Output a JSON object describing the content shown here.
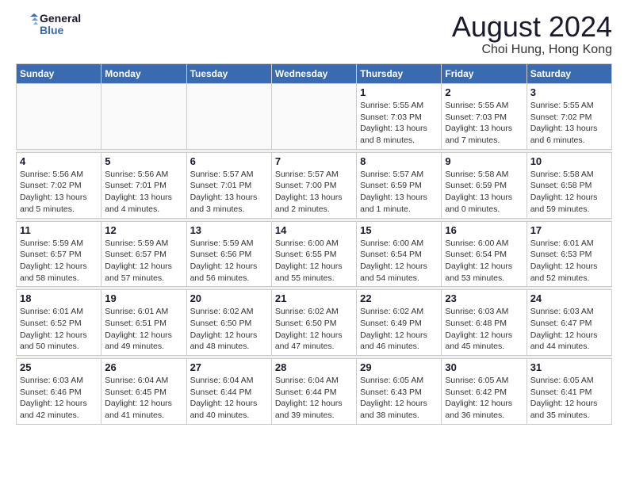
{
  "header": {
    "logo_line1": "General",
    "logo_line2": "Blue",
    "month_year": "August 2024",
    "location": "Choi Hung, Hong Kong"
  },
  "weekdays": [
    "Sunday",
    "Monday",
    "Tuesday",
    "Wednesday",
    "Thursday",
    "Friday",
    "Saturday"
  ],
  "weeks": [
    [
      {
        "day": "",
        "info": ""
      },
      {
        "day": "",
        "info": ""
      },
      {
        "day": "",
        "info": ""
      },
      {
        "day": "",
        "info": ""
      },
      {
        "day": "1",
        "info": "Sunrise: 5:55 AM\nSunset: 7:03 PM\nDaylight: 13 hours\nand 8 minutes."
      },
      {
        "day": "2",
        "info": "Sunrise: 5:55 AM\nSunset: 7:03 PM\nDaylight: 13 hours\nand 7 minutes."
      },
      {
        "day": "3",
        "info": "Sunrise: 5:55 AM\nSunset: 7:02 PM\nDaylight: 13 hours\nand 6 minutes."
      }
    ],
    [
      {
        "day": "4",
        "info": "Sunrise: 5:56 AM\nSunset: 7:02 PM\nDaylight: 13 hours\nand 5 minutes."
      },
      {
        "day": "5",
        "info": "Sunrise: 5:56 AM\nSunset: 7:01 PM\nDaylight: 13 hours\nand 4 minutes."
      },
      {
        "day": "6",
        "info": "Sunrise: 5:57 AM\nSunset: 7:01 PM\nDaylight: 13 hours\nand 3 minutes."
      },
      {
        "day": "7",
        "info": "Sunrise: 5:57 AM\nSunset: 7:00 PM\nDaylight: 13 hours\nand 2 minutes."
      },
      {
        "day": "8",
        "info": "Sunrise: 5:57 AM\nSunset: 6:59 PM\nDaylight: 13 hours\nand 1 minute."
      },
      {
        "day": "9",
        "info": "Sunrise: 5:58 AM\nSunset: 6:59 PM\nDaylight: 13 hours\nand 0 minutes."
      },
      {
        "day": "10",
        "info": "Sunrise: 5:58 AM\nSunset: 6:58 PM\nDaylight: 12 hours\nand 59 minutes."
      }
    ],
    [
      {
        "day": "11",
        "info": "Sunrise: 5:59 AM\nSunset: 6:57 PM\nDaylight: 12 hours\nand 58 minutes."
      },
      {
        "day": "12",
        "info": "Sunrise: 5:59 AM\nSunset: 6:57 PM\nDaylight: 12 hours\nand 57 minutes."
      },
      {
        "day": "13",
        "info": "Sunrise: 5:59 AM\nSunset: 6:56 PM\nDaylight: 12 hours\nand 56 minutes."
      },
      {
        "day": "14",
        "info": "Sunrise: 6:00 AM\nSunset: 6:55 PM\nDaylight: 12 hours\nand 55 minutes."
      },
      {
        "day": "15",
        "info": "Sunrise: 6:00 AM\nSunset: 6:54 PM\nDaylight: 12 hours\nand 54 minutes."
      },
      {
        "day": "16",
        "info": "Sunrise: 6:00 AM\nSunset: 6:54 PM\nDaylight: 12 hours\nand 53 minutes."
      },
      {
        "day": "17",
        "info": "Sunrise: 6:01 AM\nSunset: 6:53 PM\nDaylight: 12 hours\nand 52 minutes."
      }
    ],
    [
      {
        "day": "18",
        "info": "Sunrise: 6:01 AM\nSunset: 6:52 PM\nDaylight: 12 hours\nand 50 minutes."
      },
      {
        "day": "19",
        "info": "Sunrise: 6:01 AM\nSunset: 6:51 PM\nDaylight: 12 hours\nand 49 minutes."
      },
      {
        "day": "20",
        "info": "Sunrise: 6:02 AM\nSunset: 6:50 PM\nDaylight: 12 hours\nand 48 minutes."
      },
      {
        "day": "21",
        "info": "Sunrise: 6:02 AM\nSunset: 6:50 PM\nDaylight: 12 hours\nand 47 minutes."
      },
      {
        "day": "22",
        "info": "Sunrise: 6:02 AM\nSunset: 6:49 PM\nDaylight: 12 hours\nand 46 minutes."
      },
      {
        "day": "23",
        "info": "Sunrise: 6:03 AM\nSunset: 6:48 PM\nDaylight: 12 hours\nand 45 minutes."
      },
      {
        "day": "24",
        "info": "Sunrise: 6:03 AM\nSunset: 6:47 PM\nDaylight: 12 hours\nand 44 minutes."
      }
    ],
    [
      {
        "day": "25",
        "info": "Sunrise: 6:03 AM\nSunset: 6:46 PM\nDaylight: 12 hours\nand 42 minutes."
      },
      {
        "day": "26",
        "info": "Sunrise: 6:04 AM\nSunset: 6:45 PM\nDaylight: 12 hours\nand 41 minutes."
      },
      {
        "day": "27",
        "info": "Sunrise: 6:04 AM\nSunset: 6:44 PM\nDaylight: 12 hours\nand 40 minutes."
      },
      {
        "day": "28",
        "info": "Sunrise: 6:04 AM\nSunset: 6:44 PM\nDaylight: 12 hours\nand 39 minutes."
      },
      {
        "day": "29",
        "info": "Sunrise: 6:05 AM\nSunset: 6:43 PM\nDaylight: 12 hours\nand 38 minutes."
      },
      {
        "day": "30",
        "info": "Sunrise: 6:05 AM\nSunset: 6:42 PM\nDaylight: 12 hours\nand 36 minutes."
      },
      {
        "day": "31",
        "info": "Sunrise: 6:05 AM\nSunset: 6:41 PM\nDaylight: 12 hours\nand 35 minutes."
      }
    ]
  ]
}
